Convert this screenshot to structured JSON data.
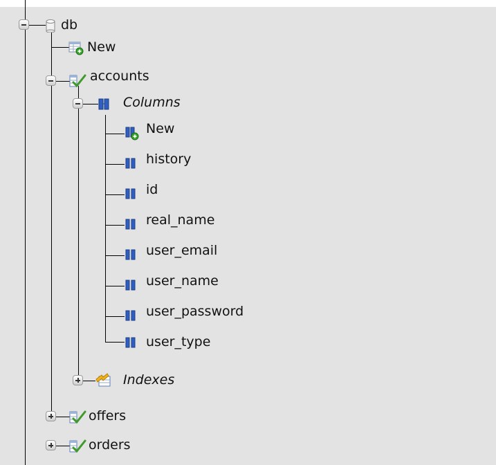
{
  "tree": {
    "db": {
      "label": "db",
      "icon": "database-icon",
      "expanded": true
    },
    "new_table": {
      "label": "New",
      "icon": "new-table-icon"
    },
    "accounts": {
      "label": "accounts",
      "icon": "table-icon",
      "expanded": true
    },
    "columns": {
      "label": "Columns",
      "icon": "columns-icon",
      "expanded": true
    },
    "column_items": [
      {
        "label": "New",
        "icon": "new-column-icon"
      },
      {
        "label": "history",
        "icon": "column-icon"
      },
      {
        "label": "id",
        "icon": "column-icon"
      },
      {
        "label": "real_name",
        "icon": "column-icon"
      },
      {
        "label": "user_email",
        "icon": "column-icon"
      },
      {
        "label": "user_name",
        "icon": "column-icon"
      },
      {
        "label": "user_password",
        "icon": "column-icon"
      },
      {
        "label": "user_type",
        "icon": "column-icon"
      }
    ],
    "indexes": {
      "label": "Indexes",
      "icon": "indexes-icon",
      "expanded": false
    },
    "offers": {
      "label": "offers",
      "icon": "table-icon",
      "expanded": false
    },
    "orders": {
      "label": "orders",
      "icon": "table-icon",
      "expanded": false
    }
  },
  "colors": {
    "panel_bg": "#e3e3e3",
    "column_icon": "#2f5fc0",
    "table_check": "#3f9a2a",
    "plus_badge": "#3aa52e",
    "index_icon": "#f1b21c"
  }
}
